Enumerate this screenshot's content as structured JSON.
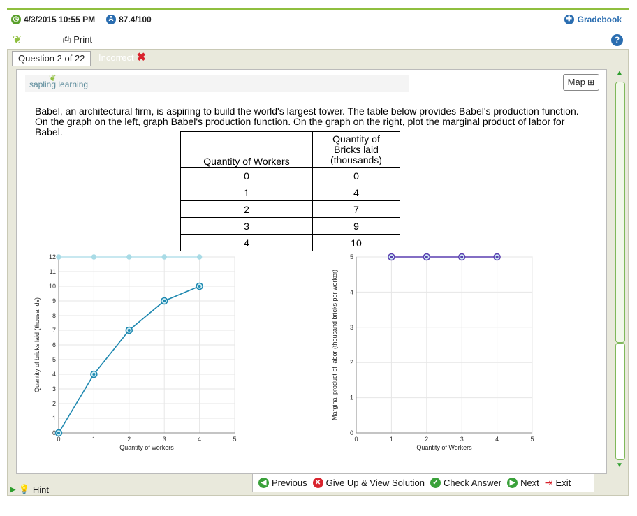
{
  "header": {
    "datetime": "4/3/2015 10:55 PM",
    "score": "87.4/100",
    "gradebook_label": "Gradebook",
    "print_label": "Print",
    "help_glyph": "?"
  },
  "tabs": {
    "question_label": "Question 2 of 22",
    "status_label": "Incorrect"
  },
  "brand": {
    "logo_text": "sapling learning"
  },
  "map_label": "Map",
  "question_text": "Babel, an architectural firm, is aspiring to build the world's largest tower. The table below provides Babel's production function. On the graph on the left, graph Babel's production function. On the graph on the right, plot the marginal product of labor for Babel.",
  "table": {
    "headers": [
      "Quantity of Workers",
      "Quantity of Bricks laid (thousands)"
    ],
    "rows": [
      [
        "0",
        "0"
      ],
      [
        "1",
        "4"
      ],
      [
        "2",
        "7"
      ],
      [
        "3",
        "9"
      ],
      [
        "4",
        "10"
      ]
    ]
  },
  "chart_data": [
    {
      "type": "line",
      "xlabel": "Quantity of workers",
      "ylabel": "Quantity of bricks laid (thousands)",
      "xlim": [
        0,
        5
      ],
      "ylim": [
        0,
        12
      ],
      "xticks": [
        "0",
        "1",
        "2",
        "3",
        "4",
        "5"
      ],
      "yticks": [
        "0",
        "1",
        "2",
        "3",
        "4",
        "5",
        "6",
        "7",
        "8",
        "9",
        "10",
        "11",
        "12"
      ],
      "series": [
        {
          "x": [
            0,
            1,
            2,
            3,
            4
          ],
          "y": [
            0,
            4,
            7,
            9,
            10
          ],
          "color": "#1e88b0"
        },
        {
          "x": [
            0,
            1,
            2,
            3,
            4
          ],
          "y": [
            12,
            12,
            12,
            12,
            12
          ],
          "color": "#a8dbe6"
        }
      ],
      "grid": true
    },
    {
      "type": "line",
      "xlabel": "Quantity of Workers",
      "ylabel": "Marginal product of labor (thousand bricks per worker)",
      "xlim": [
        0,
        5
      ],
      "ylim": [
        0,
        5
      ],
      "xticks": [
        "0",
        "1",
        "2",
        "3",
        "4",
        "5"
      ],
      "yticks": [
        "0",
        "1",
        "2",
        "3",
        "4",
        "5"
      ],
      "series": [
        {
          "x": [
            1,
            2,
            3,
            4
          ],
          "y": [
            5,
            5,
            5,
            5
          ],
          "color": "#5a3fb0"
        }
      ],
      "grid": true
    }
  ],
  "bottom": {
    "hint_label": "Hint",
    "previous_label": "Previous",
    "giveup_label": "Give Up & View Solution",
    "check_label": "Check Answer",
    "next_label": "Next",
    "exit_label": "Exit"
  },
  "colors": {
    "accent_green": "#8fbf3f",
    "link_blue": "#2a6db0",
    "incorrect_red": "#d9232d"
  }
}
